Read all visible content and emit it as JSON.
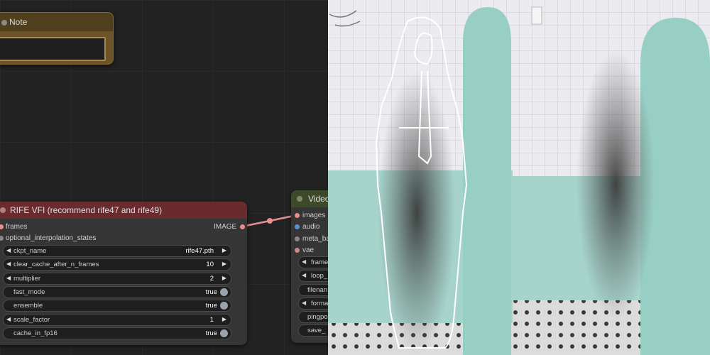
{
  "note_node": {
    "title": "Note"
  },
  "rife_node": {
    "title": "RIFE VFI (recommend rife47 and rife49)",
    "inputs": [
      "frames",
      "optional_interpolation_states"
    ],
    "output": "IMAGE",
    "widgets": {
      "ckpt_name": {
        "label": "ckpt_name",
        "value": "rife47.pth"
      },
      "clear_cache": {
        "label": "clear_cache_after_n_frames",
        "value": "10"
      },
      "multiplier": {
        "label": "multiplier",
        "value": "2"
      },
      "fast_mode": {
        "label": "fast_mode",
        "value": "true"
      },
      "ensemble": {
        "label": "ensemble",
        "value": "true"
      },
      "scale_factor": {
        "label": "scale_factor",
        "value": "1"
      },
      "cache_in_fp16": {
        "label": "cache_in_fp16",
        "value": "true"
      }
    }
  },
  "video_node": {
    "title": "Video",
    "inputs": [
      "images",
      "audio",
      "meta_ba",
      "vae"
    ],
    "widgets": [
      "frame",
      "loop_",
      "filenan",
      "forma",
      "pingpo",
      "save_"
    ]
  },
  "colors": {
    "image_link": "#e88e8e",
    "node_bg": "#353535",
    "rife_header": "#6a2b2f",
    "note_bg": "#6b5528",
    "tile_wall": "#ececf0",
    "mint_wall": "#9fd0c5"
  }
}
